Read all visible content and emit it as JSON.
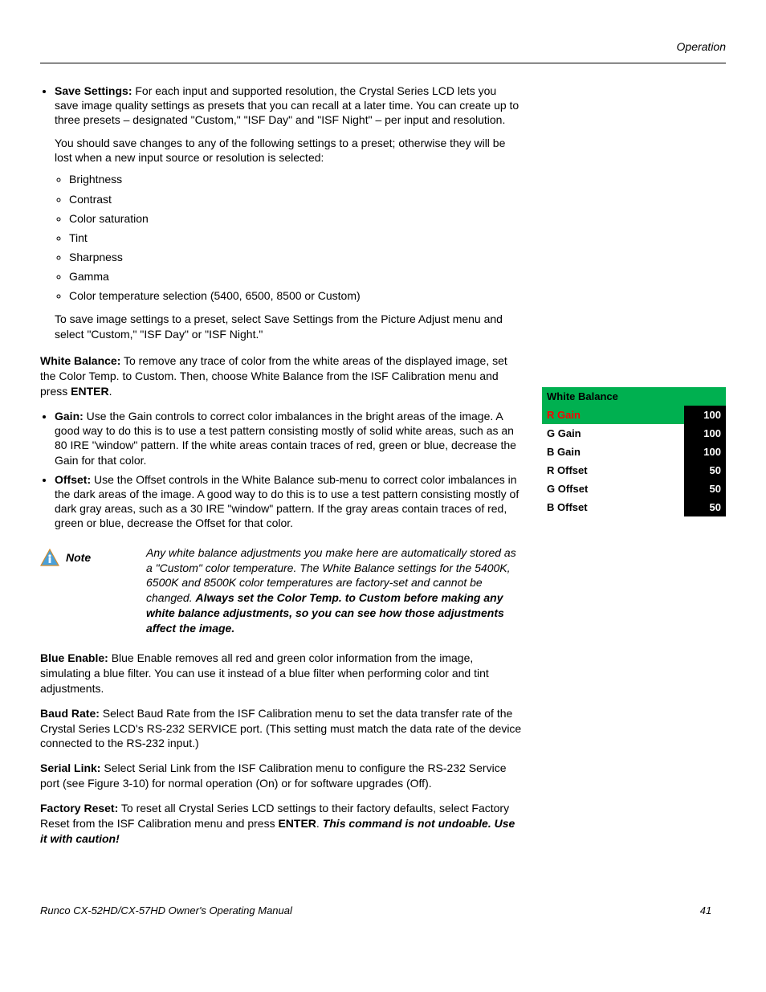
{
  "header": {
    "section": "Operation"
  },
  "save_settings": {
    "heading": "Save Settings:",
    "text1": "For each input and supported resolution, the Crystal Series LCD lets you save image quality settings as presets that you can recall at a later time. You can create up to three presets – designated \"Custom,\" \"ISF Day\" and \"ISF Night\" – per input and resolution.",
    "text2": "You should save changes to any of the following settings to a preset; otherwise they will be lost when a new input source or resolution is selected:",
    "items": [
      "Brightness",
      "Contrast",
      "Color saturation",
      "Tint",
      "Sharpness",
      "Gamma",
      "Color temperature selection (5400, 6500, 8500 or Custom)"
    ],
    "text3": "To save image settings to a preset, select Save Settings from the Picture Adjust menu and select \"Custom,\" \"ISF Day\" or \"ISF Night.\""
  },
  "white_balance": {
    "heading": "White Balance:",
    "text": "To remove any trace of color from the white areas of the displayed image, set the Color Temp. to Custom. Then, choose White Balance from the ISF Calibration menu and press ",
    "enter": "ENTER",
    "period": ".",
    "gain_h": "Gain:",
    "gain_t": "Use the Gain controls to correct color imbalances in the bright areas of the image. A good way to do this is to use a test pattern consisting mostly of solid white areas, such as an 80 IRE \"window\" pattern. If the white areas contain traces of red, green or blue, decrease the Gain for that color.",
    "offset_h": "Offset:",
    "offset_t": "Use the Offset controls in the White Balance sub-menu to correct color imbalances in the dark areas of the image. A good way to do this is to use a test pattern consisting mostly of dark gray areas, such as a 30 IRE \"window\" pattern. If the gray areas contain traces of red, green or blue, decrease the Offset for that color."
  },
  "note": {
    "label": "Note",
    "text1": "Any white balance adjustments you make here are automatically stored as a \"Custom\" color temperature. The White Balance settings for the 5400K, 6500K and 8500K color temperatures are factory-set and cannot be changed. ",
    "bold": "Always set the Color Temp. to Custom before making any white balance adjustments, so you can see how those adjustments affect the image."
  },
  "blue_enable": {
    "heading": "Blue Enable:",
    "text": "Blue Enable removes all red and green color information from the image, simulating a blue filter. You can use it instead of a blue filter when performing color and tint adjustments."
  },
  "baud_rate": {
    "heading": "Baud Rate:",
    "text": "Select Baud Rate from the ISF Calibration menu to set the data transfer rate of the Crystal Series LCD's RS-232 SERVICE port. (This setting must match the data rate of the device connected to the RS-232 input.)"
  },
  "serial_link": {
    "heading": "Serial Link:",
    "text": "Select Serial Link from the ISF Calibration menu to configure the RS-232 Service port (see Figure 3-10) for normal operation (On) or for software upgrades (Off)."
  },
  "factory_reset": {
    "heading": "Factory Reset:",
    "text1": "To reset all Crystal Series LCD settings to their factory defaults, select Factory Reset from the ISF Calibration menu and press ",
    "enter": "ENTER",
    "period": ". ",
    "warn": "This command is not undoable. Use it with caution!"
  },
  "wb_table": {
    "title": "White Balance",
    "rows": [
      {
        "label": "R Gain",
        "value": "100",
        "hl": true
      },
      {
        "label": "G Gain",
        "value": "100",
        "hl": false
      },
      {
        "label": "B Gain",
        "value": "100",
        "hl": false
      },
      {
        "label": "R Offset",
        "value": "50",
        "hl": false
      },
      {
        "label": "G Offset",
        "value": "50",
        "hl": false
      },
      {
        "label": "B Offset",
        "value": "50",
        "hl": false
      }
    ]
  },
  "footer": {
    "title": "Runco CX-52HD/CX-57HD Owner's Operating Manual",
    "page": "41"
  }
}
